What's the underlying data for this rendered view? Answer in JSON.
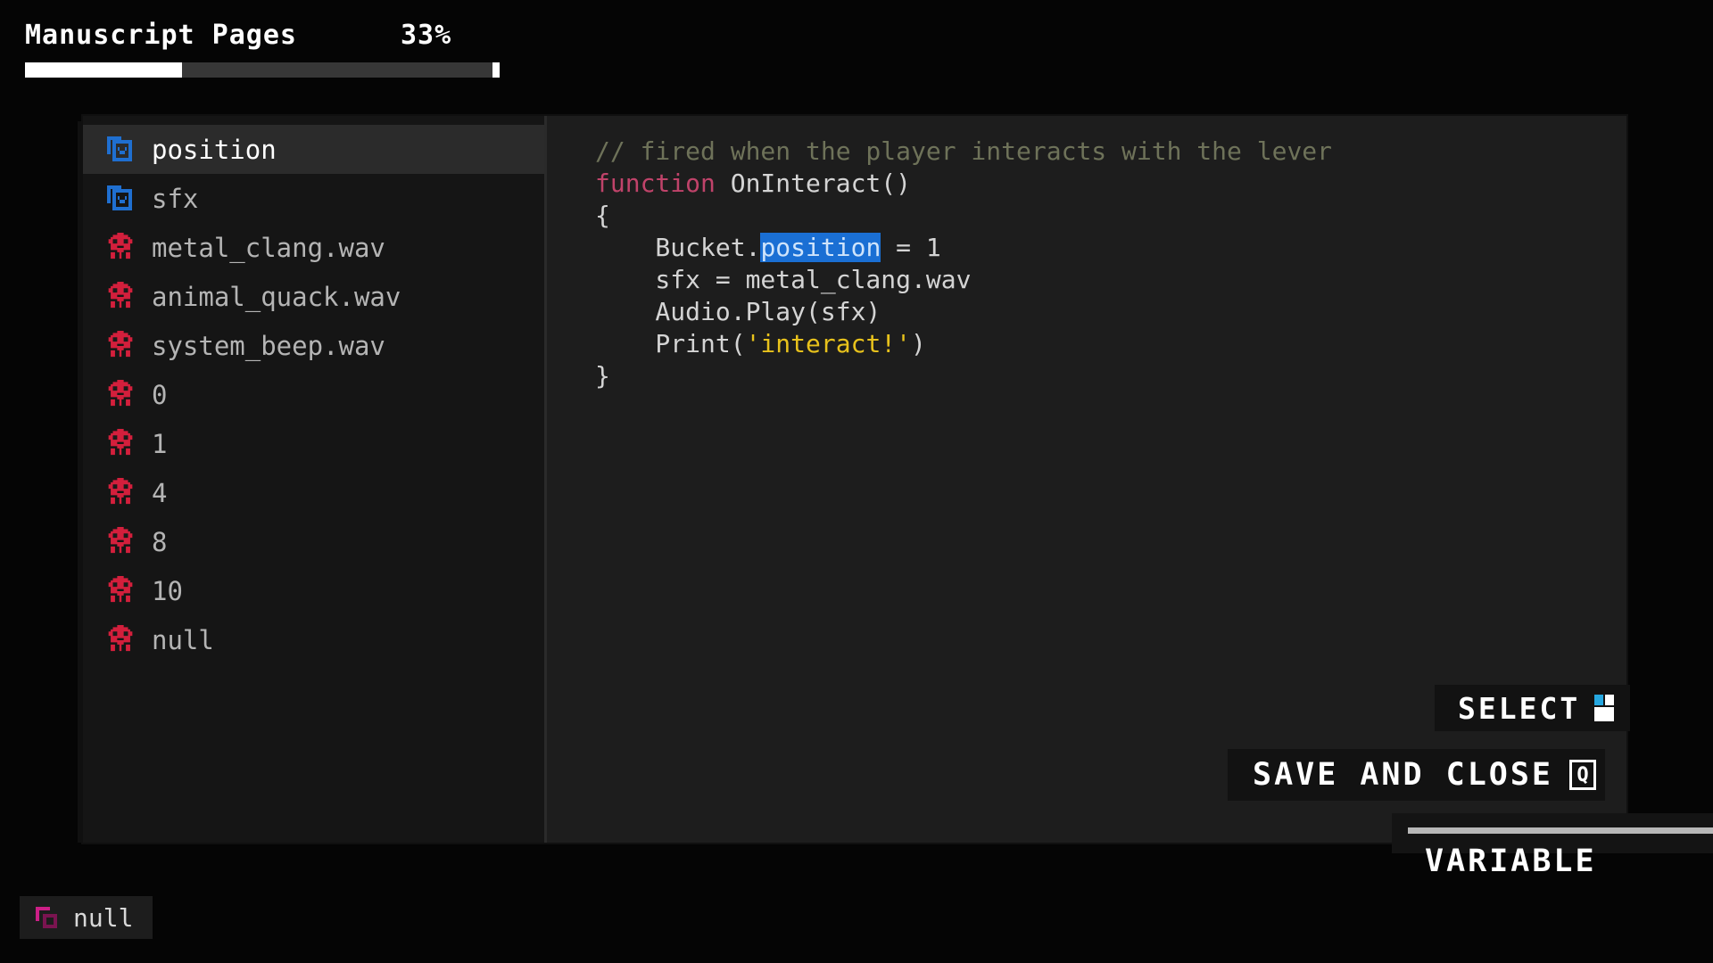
{
  "header": {
    "title": "Manuscript Pages",
    "percent_label": "33%",
    "percent_value": 33,
    "bar_fill_color": "#ffffff",
    "bar_track_color": "#373737"
  },
  "sidebar": {
    "items": [
      {
        "label": "position",
        "icon": "variable-box-icon",
        "icon_color": "#1f6fd0",
        "selected": true
      },
      {
        "label": "sfx",
        "icon": "variable-box-icon",
        "icon_color": "#1f6fd0",
        "selected": false
      },
      {
        "label": "metal_clang.wav",
        "icon": "skull-icon",
        "icon_color": "#d31f3c",
        "selected": false
      },
      {
        "label": "animal_quack.wav",
        "icon": "skull-icon",
        "icon_color": "#d31f3c",
        "selected": false
      },
      {
        "label": "system_beep.wav",
        "icon": "skull-icon",
        "icon_color": "#d31f3c",
        "selected": false
      },
      {
        "label": "0",
        "icon": "skull-icon",
        "icon_color": "#d31f3c",
        "selected": false
      },
      {
        "label": "1",
        "icon": "skull-icon",
        "icon_color": "#d31f3c",
        "selected": false
      },
      {
        "label": "4",
        "icon": "skull-icon",
        "icon_color": "#d31f3c",
        "selected": false
      },
      {
        "label": "8",
        "icon": "skull-icon",
        "icon_color": "#d31f3c",
        "selected": false
      },
      {
        "label": "10",
        "icon": "skull-icon",
        "icon_color": "#d31f3c",
        "selected": false
      },
      {
        "label": "null",
        "icon": "skull-icon",
        "icon_color": "#d31f3c",
        "selected": false
      }
    ]
  },
  "code": {
    "lines": [
      {
        "tokens": [
          {
            "text": "// fired when the player interacts with the lever",
            "type": "comment"
          }
        ]
      },
      {
        "tokens": [
          {
            "text": "function",
            "type": "keyword"
          },
          {
            "text": " OnInteract()",
            "type": "plain"
          }
        ]
      },
      {
        "tokens": [
          {
            "text": "{",
            "type": "plain"
          }
        ]
      },
      {
        "tokens": [
          {
            "text": "    Bucket.",
            "type": "plain"
          },
          {
            "text": "position",
            "type": "selected"
          },
          {
            "text": " = 1",
            "type": "plain"
          }
        ]
      },
      {
        "tokens": [
          {
            "text": "    sfx = metal_clang.wav",
            "type": "plain"
          }
        ]
      },
      {
        "tokens": [
          {
            "text": "    Audio.Play(sfx)",
            "type": "plain"
          }
        ]
      },
      {
        "tokens": [
          {
            "text": "    Print(",
            "type": "plain"
          },
          {
            "text": "'interact!'",
            "type": "string"
          },
          {
            "text": ")",
            "type": "plain"
          }
        ]
      },
      {
        "tokens": [
          {
            "text": "}",
            "type": "plain"
          }
        ]
      }
    ],
    "colors": {
      "comment": "#6e7259",
      "keyword": "#c0436a",
      "string": "#e8c21c",
      "plain": "#d4d4d4",
      "selection_bg": "#1a6fd4",
      "selection_fg": "#cfe4fb"
    }
  },
  "hints": {
    "select": {
      "label": "SELECT",
      "icon": "mouse-icon"
    },
    "save_and_close": {
      "label": "SAVE AND CLOSE",
      "key": "Q",
      "icon": "keyboard-key-icon"
    }
  },
  "tooltip": {
    "label": "VARIABLE"
  },
  "chip": {
    "label": "null",
    "icon": "double-square-icon",
    "icon_color": "#cc1f86"
  }
}
